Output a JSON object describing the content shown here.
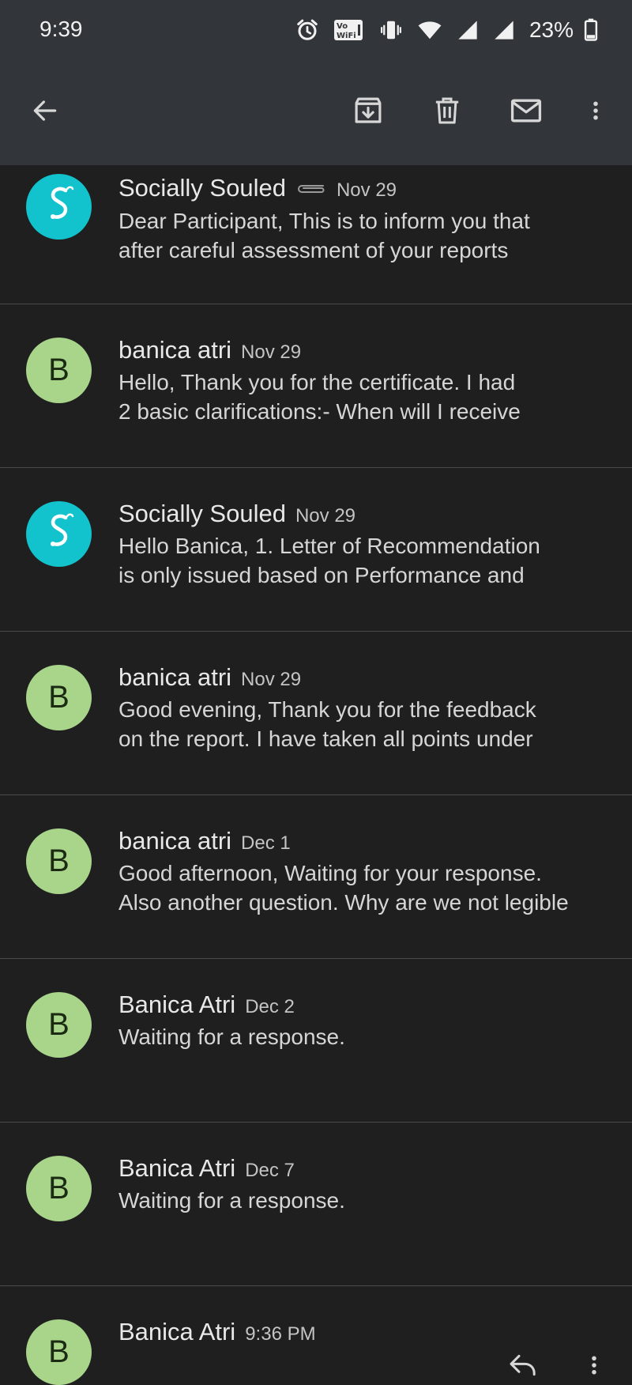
{
  "status": {
    "time": "9:39",
    "battery": "23%",
    "icons": [
      "alarm-icon",
      "vowifi-icon",
      "vibrate-icon",
      "wifi-icon",
      "signal-icon",
      "signal-icon",
      "battery-icon"
    ]
  },
  "toolbar": {
    "icons": [
      "back-arrow-icon",
      "archive-icon",
      "delete-icon",
      "mark-unread-icon",
      "more-vert-icon"
    ]
  },
  "messages": [
    {
      "sender": "Socially Souled",
      "date": "Nov 29",
      "attachment": true,
      "line1": "Dear Participant, This is to inform you that",
      "line2": "after careful assessment of your reports"
    },
    {
      "sender": "banica atri",
      "date": "Nov 29",
      "avatar": "B",
      "line1": "Hello, Thank you for the certificate. I had",
      "line2": "2 basic clarifications:- When will I receive"
    },
    {
      "sender": "Socially Souled",
      "date": "Nov 29",
      "line1": "Hello Banica, 1. Letter of Recommendation",
      "line2": "is only issued based on Performance and"
    },
    {
      "sender": "banica atri",
      "date": "Nov 29",
      "avatar": "B",
      "line1": "Good evening, Thank you for the feedback",
      "line2": "on the report. I have taken all points under"
    },
    {
      "sender": "banica atri",
      "date": "Dec 1",
      "avatar": "B",
      "line1": "Good afternoon, Waiting for your response.",
      "line2": "Also another question. Why are we not legible"
    },
    {
      "sender": "Banica Atri",
      "date": "Dec 2",
      "avatar": "B",
      "line1": "Waiting for a response.",
      "line2": ""
    },
    {
      "sender": "Banica Atri",
      "date": "Dec 7",
      "avatar": "B",
      "line1": "Waiting for a response.",
      "line2": ""
    },
    {
      "sender": "Banica Atri",
      "date": "9:36 PM",
      "avatar": "B",
      "line1": "",
      "line2": ""
    }
  ]
}
